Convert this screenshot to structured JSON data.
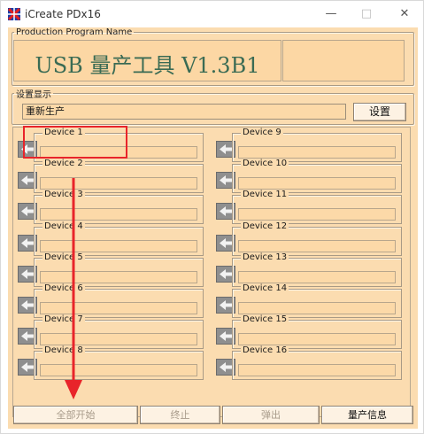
{
  "window": {
    "title": "iCreate PDx16",
    "minimize_glyph": "—",
    "maximize_glyph": "□",
    "close_glyph": "✕"
  },
  "production": {
    "group_label": "Production Program Name",
    "program_name": "USB 量产工具 V1.3B1"
  },
  "settings": {
    "group_label": "设置显示",
    "display_value": "重新生产",
    "button_label": "设置"
  },
  "devices": {
    "left": [
      {
        "label": "Device 1",
        "value": ""
      },
      {
        "label": "Device 2",
        "value": ""
      },
      {
        "label": "Device 3",
        "value": ""
      },
      {
        "label": "Device 4",
        "value": ""
      },
      {
        "label": "Device 5",
        "value": ""
      },
      {
        "label": "Device 6",
        "value": ""
      },
      {
        "label": "Device 7",
        "value": ""
      },
      {
        "label": "Device 8",
        "value": ""
      }
    ],
    "right": [
      {
        "label": "Device 9",
        "value": ""
      },
      {
        "label": "Device 10",
        "value": ""
      },
      {
        "label": "Device 11",
        "value": ""
      },
      {
        "label": "Device 12",
        "value": ""
      },
      {
        "label": "Device 13",
        "value": ""
      },
      {
        "label": "Device 14",
        "value": ""
      },
      {
        "label": "Device 15",
        "value": ""
      },
      {
        "label": "Device 16",
        "value": ""
      }
    ]
  },
  "actions": {
    "start_all": "全部开始",
    "stop": "终止",
    "eject": "弹出",
    "production_info": "量产信息"
  },
  "colors": {
    "client_bg": "#fbdcb0",
    "program_text": "#3a6b54",
    "highlight_red": "#e8242a"
  },
  "icons": {
    "app": "app-logo-icon",
    "device_port": "left-arrow-port-icon",
    "annotation": "red-down-arrow-annotation"
  }
}
